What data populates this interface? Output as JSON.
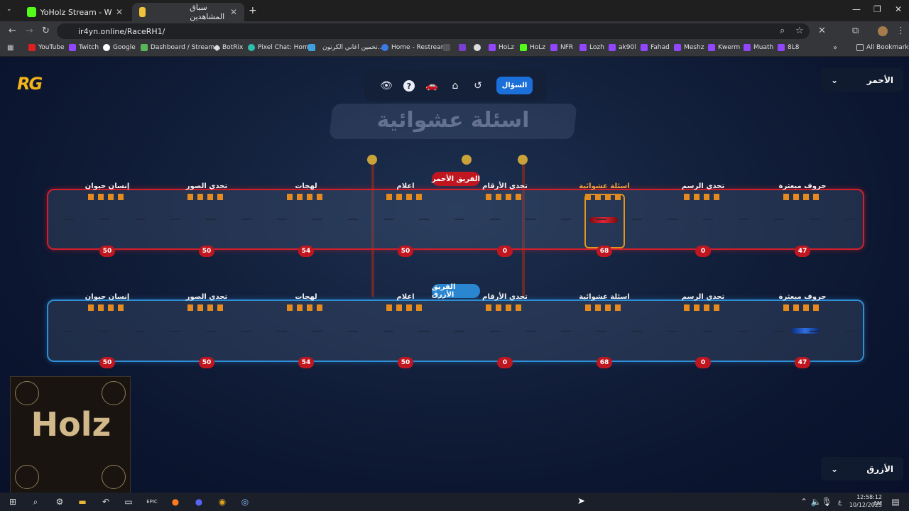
{
  "browser": {
    "tabs": [
      {
        "title": "YoHolz Stream - Watch Live on",
        "active": false
      },
      {
        "title": "سباق المشاهدين",
        "active": true
      }
    ],
    "new_tab": "+",
    "url": "ir4yn.online/RaceRH1/",
    "bookmarks": [
      "YouTube",
      "Twitch",
      "Google",
      "Dashboard / Stream...",
      "BotRix",
      "Pixel Chat: Home",
      "تخمين اغاني الكرتون...",
      "Home - Restream",
      "HoLz",
      "HoLz",
      "NFR",
      "Lozh",
      "ak90l",
      "Fahad",
      "Meshz",
      "Kwerm",
      "Muath",
      "8L8"
    ],
    "all_bookmarks": "All Bookmarks"
  },
  "game": {
    "logo": "RG",
    "question_button": "السؤال",
    "toolbar_icons": [
      "eye-icon",
      "help-icon",
      "car-icon",
      "home-icon",
      "reset-icon"
    ],
    "banner_title": "اسئلة عشوائية",
    "red_dropdown": "الأحمر",
    "blue_dropdown": "الأزرق",
    "red_team_label": "الفريق الأحمر",
    "blue_team_label": "الفريق الأزرق",
    "categories": [
      {
        "label": "حروف مبعثرة",
        "score": "47",
        "active": false
      },
      {
        "label": "تحدي الرسم",
        "score": "0",
        "active": false
      },
      {
        "label": "اسئلة عشوائية",
        "score": "68",
        "active": true
      },
      {
        "label": "تحدي الأرقام",
        "score": "0",
        "active": false
      },
      {
        "label": "اعلام",
        "score": "50",
        "active": false
      },
      {
        "label": "لهجات",
        "score": "54",
        "active": false
      },
      {
        "label": "تحدي الصور",
        "score": "50",
        "active": false
      },
      {
        "label": "إنسان حيوان",
        "score": "50",
        "active": false
      }
    ],
    "blue_categories": [
      {
        "label": "حروف مبعثرة",
        "score": "47"
      },
      {
        "label": "تحدي الرسم",
        "score": "0"
      },
      {
        "label": "اسئلة عشوائية",
        "score": "68"
      },
      {
        "label": "تحدي الأرقام",
        "score": "0"
      },
      {
        "label": "اعلام",
        "score": "50"
      },
      {
        "label": "لهجات",
        "score": "54"
      },
      {
        "label": "تحدي الصور",
        "score": "50"
      },
      {
        "label": "إنسان حيوان",
        "score": "50"
      }
    ],
    "red_car_position_category": "اسئلة عشوائية",
    "blue_car_position_category": "حروف مبعثرة",
    "colors": {
      "red": "#d11f2b",
      "blue": "#2f8fd6",
      "accent": "#f2a33a",
      "question_button": "#1b6fd8"
    }
  },
  "overlay": {
    "title": "Holz"
  },
  "taskbar": {
    "time": "12:58:12 AM",
    "date": "10/12/2025",
    "lang": "ع"
  }
}
